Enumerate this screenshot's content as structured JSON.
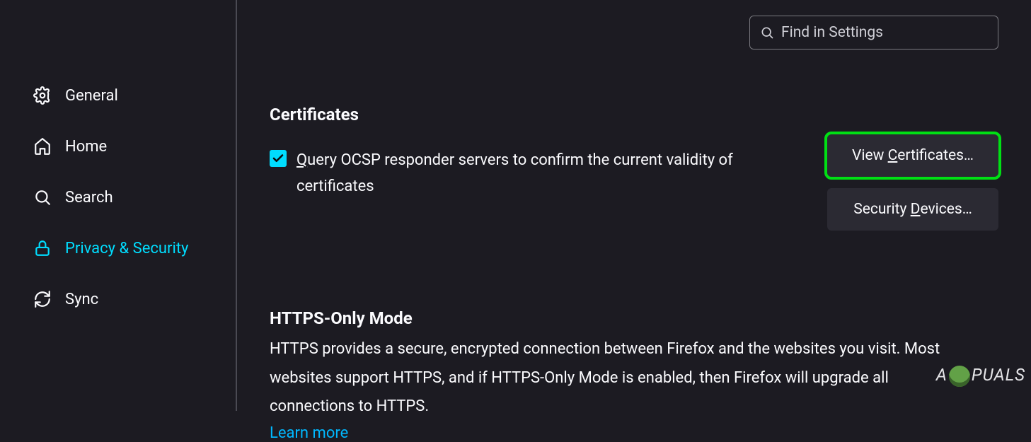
{
  "search": {
    "placeholder": "Find in Settings"
  },
  "sidebar": {
    "items": [
      {
        "label": "General"
      },
      {
        "label": "Home"
      },
      {
        "label": "Search"
      },
      {
        "label": "Privacy & Security"
      },
      {
        "label": "Sync"
      }
    ]
  },
  "certificates": {
    "heading": "Certificates",
    "ocsp_label": "Query OCSP responder servers to confirm the current validity of certificates",
    "view_button_pre": "View ",
    "view_button_u": "C",
    "view_button_post": "ertificates…",
    "devices_button_pre": "Security ",
    "devices_button_u": "D",
    "devices_button_post": "evices…"
  },
  "https": {
    "heading": "HTTPS-Only Mode",
    "desc": "HTTPS provides a secure, encrypted connection between Firefox and the websites you visit. Most websites support HTTPS, and if HTTPS-Only Mode is enabled, then Firefox will upgrade all connections to HTTPS.",
    "learn_more": "Learn more"
  },
  "watermark": {
    "pre": "A",
    "post": "PUALS"
  }
}
